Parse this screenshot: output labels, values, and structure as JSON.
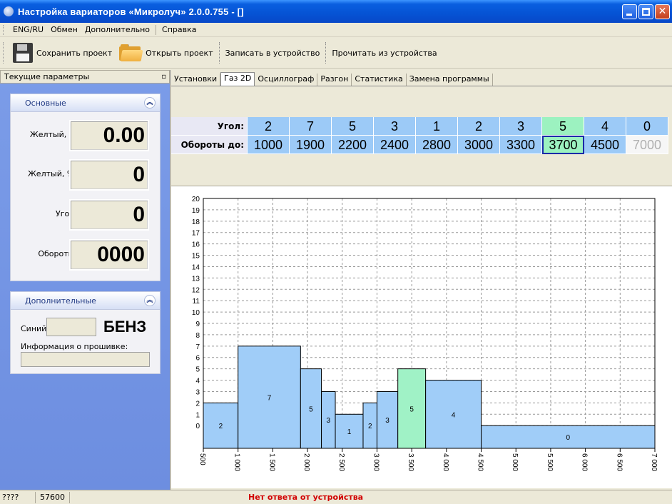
{
  "window": {
    "title": "Настройка вариаторов «Микролуч» 2.0.0.755 - []"
  },
  "menu": [
    "ENG/RU",
    "Обмен",
    "Дополнительно",
    "Справка"
  ],
  "toolbar": {
    "save_project": "Сохранить проект",
    "open_project": "Открыть проект",
    "write_device": "Записать в устройство",
    "read_device": "Прочитать из устройства"
  },
  "left_panel": {
    "header": "Текущие параметры",
    "main_group": {
      "title": "Основные",
      "rows": [
        {
          "label": "Желтый, В:",
          "value": "0.00"
        },
        {
          "label": "Желтый, %:",
          "value": "0"
        },
        {
          "label": "Угол:",
          "value": "0"
        },
        {
          "label": "Обороты:",
          "value": "0000"
        }
      ]
    },
    "extra_group": {
      "title": "Дополнительные",
      "blue_label": "Синий:",
      "fuel": "БЕНЗ",
      "firmware_label": "Информация о прошивке:"
    }
  },
  "tabs": [
    "Установки",
    "Газ 2D",
    "Осциллограф",
    "Разгон",
    "Статистика",
    "Замена программы"
  ],
  "active_tab": 1,
  "grid": {
    "angle_label": "Угол:",
    "rpm_label": "Обороты до:",
    "angles": [
      "2",
      "7",
      "5",
      "3",
      "1",
      "2",
      "3",
      "5",
      "4",
      "0"
    ],
    "rpms": [
      "1000",
      "1900",
      "2200",
      "2400",
      "2800",
      "3000",
      "3300",
      "3700",
      "4500",
      "7000"
    ],
    "selected_index": 7,
    "disabled_index": 9,
    "cell_color": "#9ccaf7",
    "selected_color": "#9cf2c0"
  },
  "chart_data": {
    "type": "bar",
    "x_axis": {
      "min": 500,
      "max": 7000,
      "ticks": [
        "500",
        "1 000",
        "1 500",
        "2 000",
        "2 500",
        "3 000",
        "3 500",
        "4 000",
        "4 500",
        "5 000",
        "5 500",
        "6 000",
        "6 500",
        "7 000"
      ]
    },
    "y_axis": {
      "min": 0,
      "max": 20,
      "ticks": [
        "0",
        "1",
        "2",
        "3",
        "4",
        "5",
        "6",
        "7",
        "8",
        "9",
        "10",
        "11",
        "12",
        "13",
        "14",
        "15",
        "16",
        "17",
        "18",
        "19",
        "20"
      ]
    },
    "grid": true,
    "bars": [
      {
        "from": 500,
        "to": 1000,
        "value": 2,
        "label": "2"
      },
      {
        "from": 1000,
        "to": 1900,
        "value": 7,
        "label": "7"
      },
      {
        "from": 1900,
        "to": 2200,
        "value": 5,
        "label": "5"
      },
      {
        "from": 2200,
        "to": 2400,
        "value": 3,
        "label": "3"
      },
      {
        "from": 2400,
        "to": 2800,
        "value": 1,
        "label": "1"
      },
      {
        "from": 2800,
        "to": 3000,
        "value": 2,
        "label": "2"
      },
      {
        "from": 3000,
        "to": 3300,
        "value": 3,
        "label": "3"
      },
      {
        "from": 3300,
        "to": 3700,
        "value": 5,
        "label": "5",
        "highlight": true
      },
      {
        "from": 3700,
        "to": 4500,
        "value": 4,
        "label": "4"
      },
      {
        "from": 4500,
        "to": 7000,
        "value": 0,
        "label": "0"
      }
    ],
    "bar_color": "#a0cdf8",
    "highlight_color": "#a0f2c6"
  },
  "statusbar": {
    "cell1": "????",
    "cell2": "57600",
    "status": "Нет ответа от устройства"
  }
}
